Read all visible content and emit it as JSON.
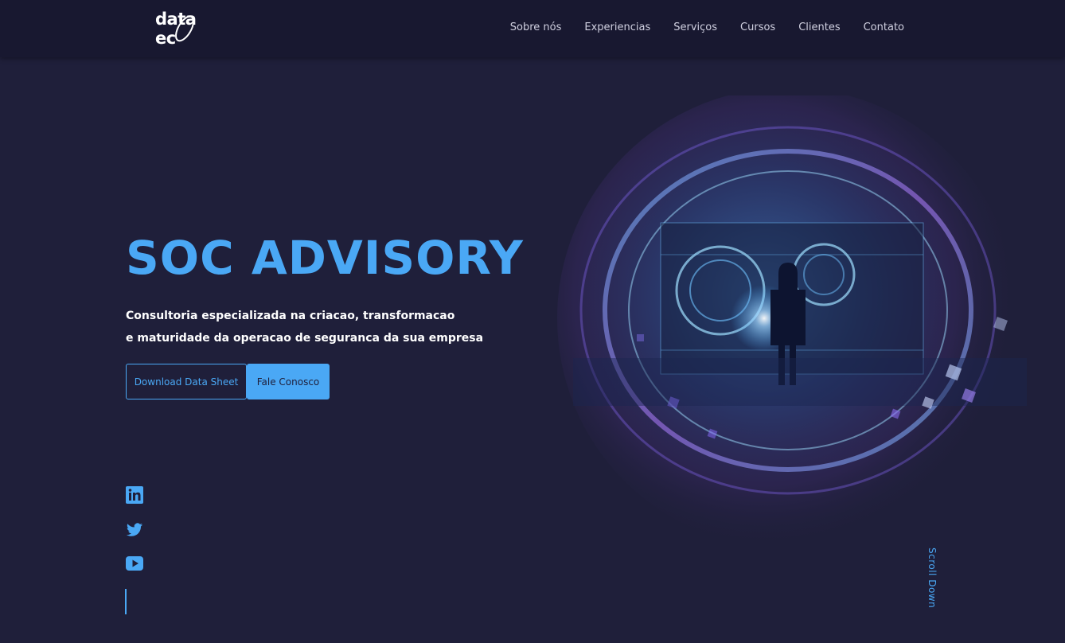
{
  "header": {
    "logo_text": "data ec",
    "nav": [
      "Sobre nós",
      "Experiencias",
      "Serviços",
      "Cursos",
      "Clientes",
      "Contato"
    ]
  },
  "hero": {
    "title": "SOC ADVISORY",
    "subtitle_line1": "Consultoria especializada na criacao, transformacao",
    "subtitle_line2": "e maturidade da operacao de seguranca da sua empresa",
    "download_button": "Download Data Sheet",
    "contact_button": "Fale Conosco"
  },
  "social": {
    "icons": [
      "linkedin-icon",
      "twitter-icon",
      "youtube-icon"
    ]
  },
  "scroll_label": "Scroll Down",
  "colors": {
    "background": "#1f1f3a",
    "navbar": "#181830",
    "accent": "#4aa8f5",
    "text": "#ffffff",
    "nav_text": "#d0d0e0"
  }
}
